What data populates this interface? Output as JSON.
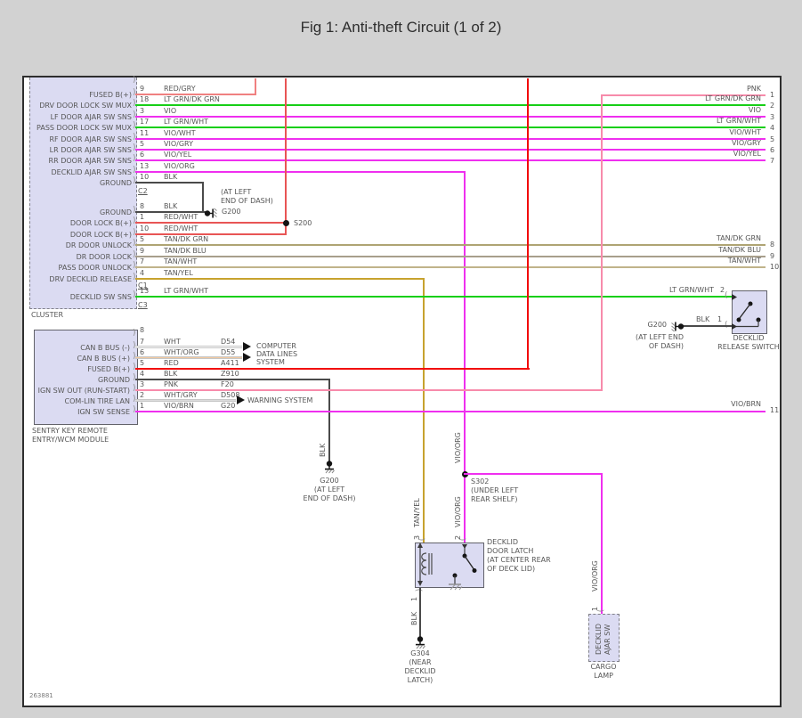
{
  "title": "Fig 1: Anti-theft Circuit (1 of 2)",
  "footer_number": "263881",
  "colors": {
    "background": "#d2d2d2",
    "paper": "#ffffff",
    "frame_border": "#2e2e2e",
    "box_fill": "#dbdbf2",
    "label_text": "#565656",
    "wire_red": "#f20c0c",
    "wire_red_wht": "#e85555",
    "wire_red_gry": "#f08080",
    "wire_pnk": "#f78bab",
    "wire_grn": "#17cf17",
    "wire_vio": "#ef2fef",
    "wire_tan_dk_grn": "#afa473",
    "wire_tan_dk_blu": "#a89f8c",
    "wire_tan_wht": "#c0b38a",
    "wire_tan_yel": "#c7a22e",
    "wire_blk": "#4a4a4a",
    "wire_wht": "#fbfbfb",
    "wire_wht_org": "#f2c9a0",
    "wire_wht_gry": "#dcdcdc"
  },
  "cluster": {
    "label": "CLUSTER",
    "connectors": {
      "c2": "C2",
      "c1": "C1",
      "c3": "C3"
    },
    "top_rows": [
      {
        "label": "FUSED B(+)",
        "pin": "9",
        "wire": "RED/GRY"
      },
      {
        "label": "DRV DOOR LOCK SW MUX",
        "pin": "18",
        "wire": "LT GRN/DK GRN"
      },
      {
        "label": "LF DOOR AJAR SW SNS",
        "pin": "3",
        "wire": "VIO"
      },
      {
        "label": "PASS DOOR LOCK SW MUX",
        "pin": "17",
        "wire": "LT GRN/WHT"
      },
      {
        "label": "RF DOOR AJAR SW SNS",
        "pin": "11",
        "wire": "VIO/WHT"
      },
      {
        "label": "LR DOOR AJAR SW SNS",
        "pin": "5",
        "wire": "VIO/GRY"
      },
      {
        "label": "RR DOOR AJAR SW SNS",
        "pin": "6",
        "wire": "VIO/YEL"
      },
      {
        "label": "DECKLID AJAR SW SNS",
        "pin": "13",
        "wire": "VIO/ORG"
      },
      {
        "label": "GROUND",
        "pin": "10",
        "wire": "BLK"
      }
    ],
    "mid_rows": [
      {
        "label": "GROUND",
        "pin": "8",
        "wire": "BLK"
      },
      {
        "label": "DOOR LOCK B(+)",
        "pin": "1",
        "wire": "RED/WHT"
      },
      {
        "label": "DOOR LOCK B(+)",
        "pin": "10",
        "wire": "RED/WHT"
      },
      {
        "label": "DR DOOR UNLOCK",
        "pin": "5",
        "wire": "TAN/DK GRN"
      },
      {
        "label": "DR DOOR LOCK",
        "pin": "9",
        "wire": "TAN/DK BLU"
      },
      {
        "label": "PASS DOOR UNLOCK",
        "pin": "7",
        "wire": "TAN/WHT"
      },
      {
        "label": "DRV DECKLID RELEASE",
        "pin": "4",
        "wire": "TAN/YEL"
      }
    ],
    "decklid_row": {
      "label": "DECKLID SW SNS",
      "pin": "13",
      "wire": "LT GRN/WHT"
    }
  },
  "wcm": {
    "label_line1": "SENTRY KEY REMOTE",
    "label_line2": "ENTRY/WCM MODULE",
    "pin8": "8",
    "rows": [
      {
        "label": "CAN B BUS (-)",
        "pin": "7",
        "wire": "WHT",
        "circuit": "D54"
      },
      {
        "label": "CAN B BUS (+)",
        "pin": "6",
        "wire": "WHT/ORG",
        "circuit": "D55"
      },
      {
        "label": "FUSED B(+)",
        "pin": "5",
        "wire": "RED",
        "circuit": "A411"
      },
      {
        "label": "GROUND",
        "pin": "4",
        "wire": "BLK",
        "circuit": "Z910"
      },
      {
        "label": "IGN SW OUT (RUN-START)",
        "pin": "3",
        "wire": "PNK",
        "circuit": "F20"
      },
      {
        "label": "COM-LIN TIRE LAN",
        "pin": "2",
        "wire": "WHT/GRY",
        "circuit": "D508"
      },
      {
        "label": "IGN SW SENSE",
        "pin": "1",
        "wire": "VIO/BRN",
        "circuit": "G20"
      }
    ],
    "computer_line1": "COMPUTER",
    "computer_line2": "DATA LINES",
    "computer_line3": "SYSTEM",
    "warning_label": "WARNING SYSTEM"
  },
  "right_edge": {
    "rows": [
      {
        "wire": "PNK",
        "pin": "1"
      },
      {
        "wire": "LT GRN/DK GRN",
        "pin": "2"
      },
      {
        "wire": "VIO",
        "pin": "3"
      },
      {
        "wire": "LT GRN/WHT",
        "pin": "4"
      },
      {
        "wire": "VIO/WHT",
        "pin": "5"
      },
      {
        "wire": "VIO/GRY",
        "pin": "6"
      },
      {
        "wire": "VIO/YEL",
        "pin": "7"
      },
      {
        "wire": "TAN/DK GRN",
        "pin": "8"
      },
      {
        "wire": "TAN/DK BLU",
        "pin": "9"
      },
      {
        "wire": "TAN/WHT",
        "pin": "10"
      },
      {
        "wire": "VIO/BRN",
        "pin": "11"
      }
    ]
  },
  "grounds": {
    "g200_cluster": {
      "name": "G200",
      "note1": "(AT LEFT",
      "note2": "END OF DASH)"
    },
    "g200_wcm": {
      "name": "G200",
      "note1": "(AT LEFT",
      "note2": "END OF DASH)"
    },
    "g200_switch": {
      "name": "G200",
      "note1": "(AT LEFT END",
      "note2": "OF DASH)"
    },
    "g304": {
      "name": "G304",
      "note1": "(NEAR",
      "note2": "DECKLID",
      "note3": "LATCH)"
    }
  },
  "splices": {
    "s200": "S200",
    "s302": {
      "name": "S302",
      "note1": "(UNDER LEFT",
      "note2": "REAR SHELF)"
    }
  },
  "release_switch": {
    "wire2": "LT GRN/WHT",
    "pin2": "2",
    "wire1": "BLK",
    "pin1": "1",
    "label_line1": "DECKLID",
    "label_line2": "RELEASE SWITCH"
  },
  "door_latch": {
    "pin3": "3",
    "pin2": "2",
    "pin1": "1",
    "label_line1": "DECKLID",
    "label_line2": "DOOR LATCH",
    "label_line3": "(AT CENTER REAR",
    "label_line4": "OF DECK LID)"
  },
  "ajar_switch": {
    "pin1": "1",
    "label_line1": "DECKLID",
    "label_line2": "AJAR SW",
    "below_line1": "CARGO",
    "below_line2": "LAMP"
  },
  "vertical_wires": {
    "blk_wcm": "BLK",
    "tan_yel": "TAN/YEL",
    "vio_org_upper": "VIO/ORG",
    "vio_org_lower": "VIO/ORG",
    "vio_org_right": "VIO/ORG",
    "blk_latch": "BLK"
  }
}
